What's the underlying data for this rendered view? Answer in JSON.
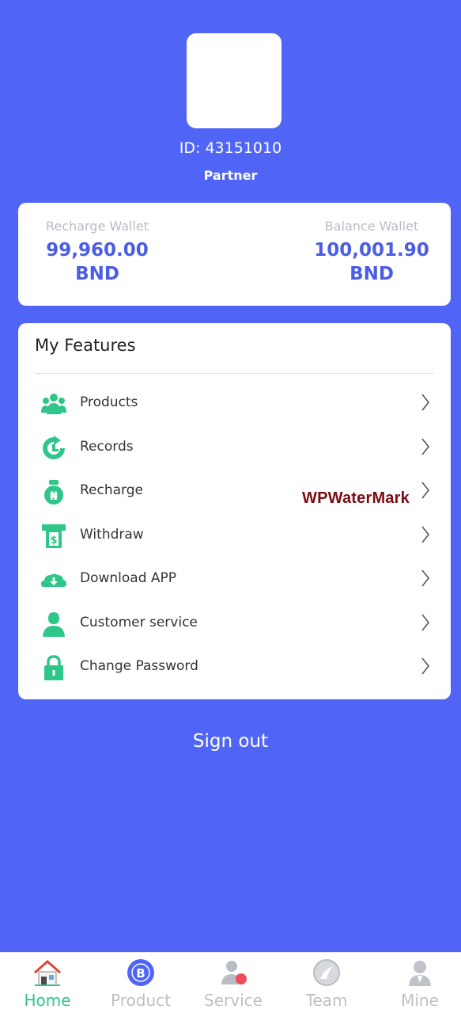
{
  "profile": {
    "id_text": "ID: 43151010",
    "role": "Partner"
  },
  "wallets": {
    "recharge": {
      "label": "Recharge Wallet",
      "amount": "99,960.00",
      "currency": "BND"
    },
    "balance": {
      "label": "Balance Wallet",
      "amount": "100,001.90",
      "currency": "BND"
    }
  },
  "features": {
    "title": "My Features",
    "items": [
      {
        "label": "Products",
        "icon": "team-icon"
      },
      {
        "label": "Records",
        "icon": "records-icon"
      },
      {
        "label": "Recharge",
        "icon": "money-bag-icon"
      },
      {
        "label": "Withdraw",
        "icon": "atm-icon"
      },
      {
        "label": "Download APP",
        "icon": "cloud-download-icon"
      },
      {
        "label": "Customer service",
        "icon": "user-icon"
      },
      {
        "label": "Change Password",
        "icon": "lock-icon"
      }
    ]
  },
  "watermark": "WPWaterMark",
  "signout_label": "Sign out",
  "tabbar": {
    "items": [
      {
        "label": "Home",
        "icon": "home-icon",
        "active": true
      },
      {
        "label": "Product",
        "icon": "product-icon",
        "active": false
      },
      {
        "label": "Service",
        "icon": "service-icon",
        "active": false
      },
      {
        "label": "Team",
        "icon": "team-icon",
        "active": false
      },
      {
        "label": "Mine",
        "icon": "profile-icon",
        "active": false
      }
    ]
  },
  "colors": {
    "background": "#5065f5",
    "accent_green": "#2fc68a",
    "wallet_value": "#4b5de4",
    "watermark": "#7a0c12"
  }
}
